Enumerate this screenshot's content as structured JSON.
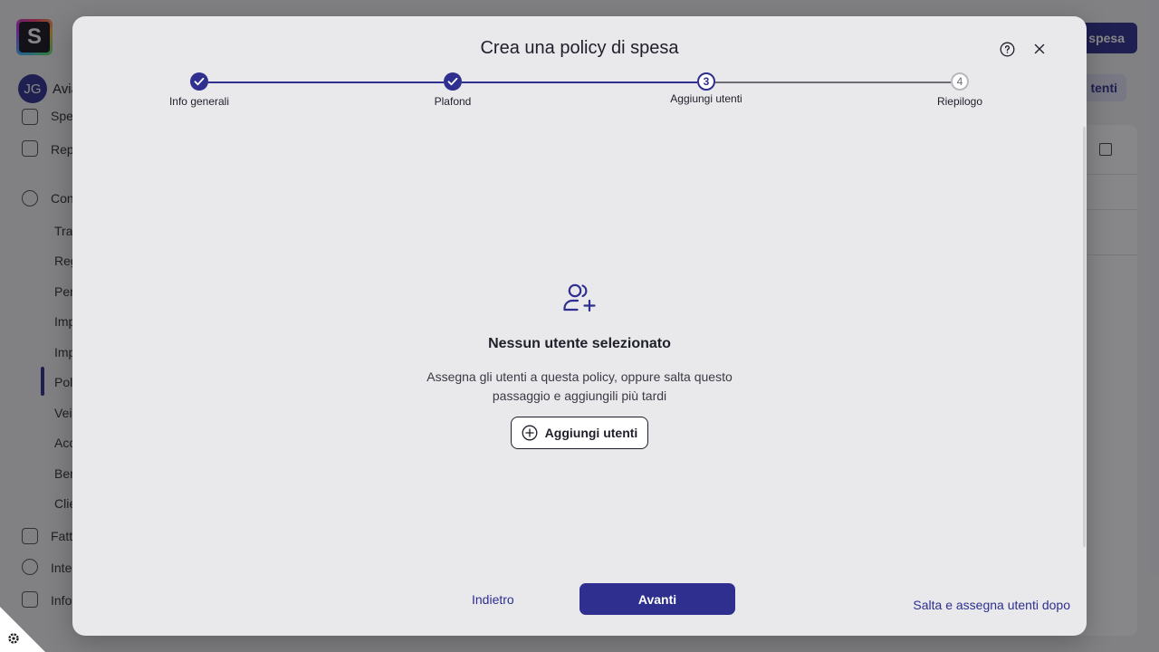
{
  "background": {
    "logo_letter": "S",
    "user": {
      "initials": "JG",
      "name_partial": "Avia"
    },
    "sidebar_items": [
      "Spe",
      "Rep",
      "Con",
      "Tra",
      "Reg",
      "Per",
      "Imp",
      "Imp",
      "Pol",
      "Vei",
      "Acc",
      "Ben",
      "Clie",
      "Fatt",
      "Inte",
      "Info"
    ],
    "top_button_partial": "spesa",
    "pill_partial": "tenti"
  },
  "modal": {
    "title": "Crea una policy di spesa",
    "help_icon": "help-circle-icon",
    "close_icon": "close-icon",
    "steps": [
      {
        "label": "Info generali",
        "state": "done"
      },
      {
        "label": "Plafond",
        "state": "done"
      },
      {
        "label": "Aggiungi utenti",
        "state": "current",
        "number": "3"
      },
      {
        "label": "Riepilogo",
        "state": "todo",
        "number": "4"
      }
    ],
    "empty_state": {
      "icon": "user-plus-icon",
      "title": "Nessun utente selezionato",
      "description_line1": "Assegna gli utenti a questa policy, oppure salta questo",
      "description_line2": "passaggio e aggiungili più tardi",
      "add_button_label": "Aggiungi utenti"
    },
    "footer": {
      "back_label": "Indietro",
      "next_label": "Avanti",
      "skip_label": "Salta e assegna utenti dopo"
    }
  },
  "colors": {
    "accent": "#2e2f8f",
    "modal_bg": "#e9e9ec"
  }
}
